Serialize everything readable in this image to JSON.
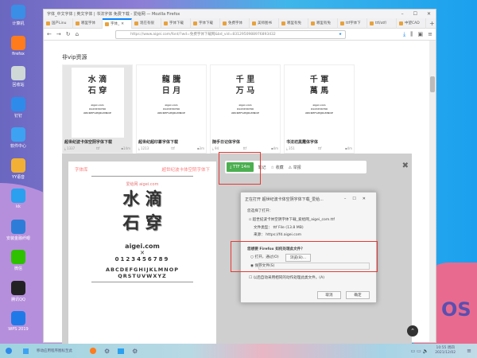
{
  "desktop": {
    "icons": [
      {
        "label": "计算机",
        "color": "#3a8ee6"
      },
      {
        "label": "firefox",
        "color": "#ff7b1c"
      },
      {
        "label": "回收站",
        "color": "#cfd8d6"
      },
      {
        "label": "钉钉",
        "color": "#2f8bea"
      },
      {
        "label": "软件中心",
        "color": "#3ea2f2"
      },
      {
        "label": "YY语音",
        "color": "#f2b134"
      },
      {
        "label": "kk",
        "color": "#2aa0ef"
      },
      {
        "label": "安装金融纤眼",
        "color": "#2d7dd8"
      },
      {
        "label": "微信",
        "color": "#2dc100"
      },
      {
        "label": "腾讯QQ",
        "color": "#222222"
      },
      {
        "label": "WPS 2019",
        "color": "#1f7ae8"
      }
    ]
  },
  "window": {
    "title": "字体_中文字体 | 英文字体 | 书法字体 免费下载 - 爱给网 — Mozilla Firefox",
    "tabs": [
      "国产Linu",
      "哪里字体",
      "字体_",
      "现在有很",
      "字体下载",
      "字体下载",
      "免费字体",
      "美师图书",
      "哪里有免",
      "哪里有免",
      "ttf字体下",
      "ttf/otf/",
      "中望CAD"
    ],
    "active_tab": 2,
    "url": "https://www.aigei.com/font/?wd=免费字体下载网&bd_vid=8312950988976893432"
  },
  "page": {
    "section_title": "非vip资源",
    "cards": [
      {
        "name": "超世纪波卡体空阴字体下载",
        "downloads": "1337",
        "format": "ttf",
        "size": "14m",
        "preview": [
          "水 滴",
          "石 穿"
        ]
      },
      {
        "name": "超世纪超印篆字体下载",
        "downloads": "1213",
        "format": "ttf",
        "size": "3m",
        "preview": [
          "龍 騰",
          "日 月"
        ]
      },
      {
        "name": "随手日记体字体",
        "downloads": "94",
        "format": "ttf",
        "size": "4m",
        "preview": [
          "千 里",
          "万 马"
        ]
      },
      {
        "name": "书法坊黑霞体字体",
        "downloads": "351",
        "format": "ttf",
        "size": "4m",
        "preview": [
          "千 軍",
          "萬 馬"
        ]
      }
    ],
    "preview": {
      "left_label": "字体库",
      "right_label": "超世纪波卡体空阴字体下",
      "watermark": "爱给网 aigei.com",
      "chars": [
        "水 滴",
        "石 穿"
      ],
      "site": "aigei.com",
      "x": "✕",
      "digits": "0123456789",
      "upper1": "ABCDEFGHIJKLMNOP",
      "upper2": "QRSTUVWXYZ"
    },
    "actions": {
      "download": "TTF 14m",
      "note": "笔记",
      "favorite": "收藏",
      "report": "举报"
    }
  },
  "dialog": {
    "title": "正在打开 超世纪波卡体空阴字体下载_爱给...",
    "chosen": "您选择了打开：",
    "filename": "超世纪波卡体空阴字体下载_爱给网_aigei_com.ttf",
    "type_label": "文件类型：",
    "type_value": "ttf File (13.8 MB)",
    "source_label": "来源：",
    "source_value": "https://fd.aigei.com",
    "question": "您想要 Firefox 如何处理此文件？",
    "open_with": "打开，通过(O)",
    "browse": "浏览(B)...",
    "save": "保存文件(S)",
    "auto": "以后自动采用相同的动作处理此类文件。(A)",
    "cancel": "取消",
    "ok": "确定",
    "selected_option": "save"
  },
  "taskbar": {
    "hint": "移动应用程序图标至此",
    "time": "10:55 周四",
    "date": "2021/12/02"
  }
}
